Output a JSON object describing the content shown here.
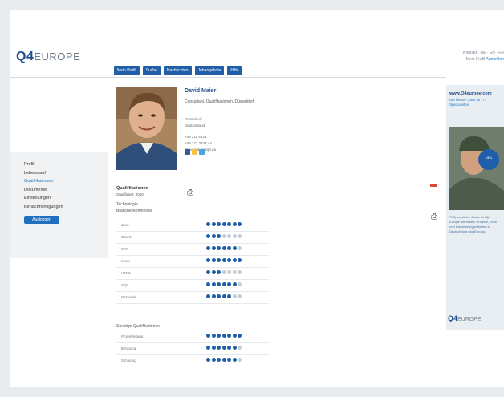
{
  "header": {
    "logo_q4": "Q4",
    "logo_europe": "EUROPE",
    "top_links": "Kontakt · DE · EN · FR",
    "login_label": "Mein Profil",
    "login_link": "Anmelden"
  },
  "nav": {
    "tabs": [
      "Mein Profil",
      "Suche",
      "Nachrichten",
      "Jobangebote",
      "Hilfe"
    ]
  },
  "sidebar": {
    "items": [
      "Profil",
      "Lebenslauf",
      "Qualifikationen",
      "Dokumente",
      "Einstellungen",
      "Benachrichtigungen"
    ],
    "active_index": 2,
    "button_label": "Ausloggen"
  },
  "profile": {
    "name": "David Maier",
    "subtitle": "Consultant, Qualifikationen, Düsseldorf",
    "contact": [
      "Düsseldorf",
      "Deutschland",
      "+49 211 4521",
      "+49 171 2233 44",
      "david.maier@q4.eu"
    ]
  },
  "qualifications": {
    "title": "Qualifikationen",
    "subtitle": "Qualifiziert: 2010",
    "section1_label": "Technologie",
    "section2_label": "Branchenkenntnisse",
    "section3_label": "Sonstige Qualifikationen",
    "skills_technology": [
      {
        "name": "Java",
        "rating": 7
      },
      {
        "name": "Oracle",
        "rating": 3
      },
      {
        "name": "SAP",
        "rating": 6
      },
      {
        "name": "Linux",
        "rating": 7
      },
      {
        "name": "HTML",
        "rating": 3
      },
      {
        "name": "SQL",
        "rating": 6
      },
      {
        "name": "Netzwerk",
        "rating": 5
      }
    ],
    "skills_other": [
      {
        "name": "Projektleitung",
        "rating": 7
      },
      {
        "name": "Beratung",
        "rating": 6
      },
      {
        "name": "Schulung",
        "rating": 6
      }
    ],
    "max_rating": 7
  },
  "ad": {
    "url": "www.Q4europe.com",
    "tagline": "Die besten Jobs für IT-Spezialisten",
    "badge": "NEU",
    "text": "IT-Spezialisten finden bei Q4 Europe die besten Projekte, Jobs und Karrieremöglichkeiten in Deutschland und Europa.",
    "logo_q4": "Q4",
    "logo_europe": "EUROPE"
  },
  "colors": {
    "brand": "#1f4e8c",
    "nav": "#1f5ea8",
    "link": "#1f78c8",
    "alert": "#d9463a"
  }
}
